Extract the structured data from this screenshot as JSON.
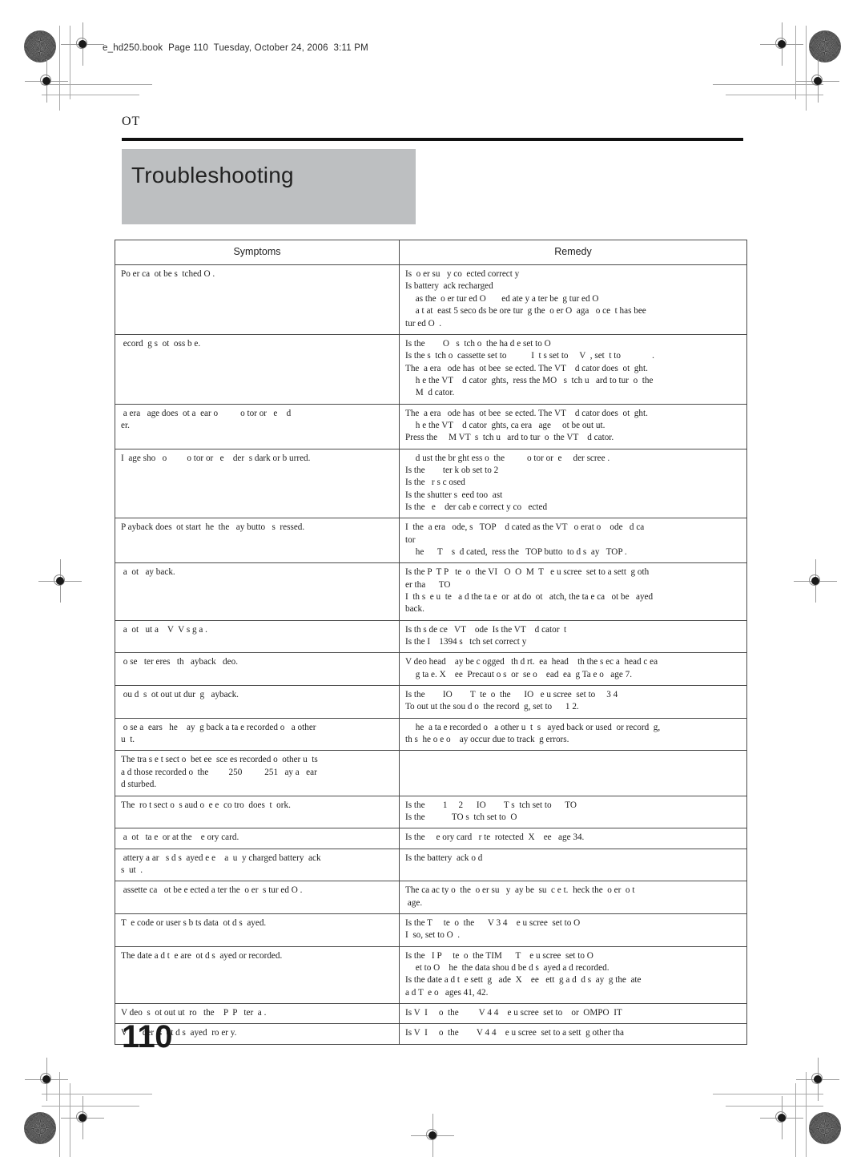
{
  "header": {
    "file_info": "e_hd250.book  Page 110  Tuesday, October 24, 2006  3:11 PM"
  },
  "page": {
    "chapter_label": "OT",
    "title": "Troubleshooting",
    "folio": "110"
  },
  "table": {
    "columns": [
      "Symptoms",
      "Remedy"
    ],
    "rows": [
      {
        "symptom": [
          "Po er ca  ot be s  tched O ."
        ],
        "remedy": [
          "Is  o er su   y co  ected correct y",
          "Is battery  ack recharged",
          " as the  o er tur ed O       ed ate y a ter be  g tur ed O",
          " a t at  east 5 seco ds be ore tur  g the  o er O  aga   o ce  t has bee",
          "tur ed O  ."
        ],
        "remedy_indent": [
          false,
          false,
          true,
          true,
          false
        ]
      },
      {
        "symptom": [
          " ecord  g s  ot  oss b e."
        ],
        "remedy": [
          "Is the        O   s  tch o  the ha d e set to O",
          "Is the s  tch o  cassette set to           I  t s set to     V  , set  t to              .",
          "The  a era   ode has  ot bee  se ected. The VT    d cator does  ot  ght.",
          " h e the VT    d cator  ghts,  ress the MO   s  tch u   ard to tur  o  the",
          " M  d cator."
        ],
        "remedy_indent": [
          false,
          false,
          false,
          true,
          true
        ]
      },
      {
        "symptom": [
          " a era   age does  ot a  ear o          o tor or   e    d",
          "er."
        ],
        "remedy": [
          "The  a era   ode has  ot bee  se ected. The VT    d cator does  ot  ght.",
          " h e the VT    d cator  ghts, ca era   age     ot be out ut.",
          "Press the     M VT  s  tch u   ard to tur  o  the VT    d cator."
        ],
        "remedy_indent": [
          false,
          true,
          false
        ]
      },
      {
        "symptom": [
          "I  age sho   o         o tor or   e    der  s dark or b urred."
        ],
        "remedy": [
          " d ust the br ght ess o  the          o tor or  e     der scree .",
          "Is the        ter k ob set to 2",
          "Is the   r s c osed",
          "Is the shutter s  eed too  ast",
          "Is the   e    der cab e correct y co   ected"
        ],
        "remedy_indent": [
          true,
          false,
          false,
          false,
          false
        ]
      },
      {
        "symptom": [
          "P ayback does  ot start  he  the   ay butto   s  ressed."
        ],
        "remedy": [
          "I  the  a era   ode, s   TOP    d cated as the VT   o erat o    ode   d ca",
          "tor",
          " he      T    s  d cated,  ress the   TOP butto  to d s  ay   TOP ."
        ],
        "remedy_indent": [
          false,
          false,
          true
        ]
      },
      {
        "symptom": [
          " a  ot   ay back."
        ],
        "remedy": [
          "Is the P  T P   te  o  the VI   O  O  M  T   e u scree  set to a sett  g oth",
          "er tha      TO",
          "I  th s  e u  te   a d the ta e  or  at do  ot   atch, the ta e ca   ot be   ayed",
          "back."
        ],
        "remedy_indent": [
          false,
          false,
          false,
          false
        ]
      },
      {
        "symptom": [
          " a  ot   ut a    V  V s g a ."
        ],
        "remedy": [
          "Is th s de ce   VT    ode  Is the VT    d cator  t",
          "Is the I    1394 s   tch set correct y"
        ],
        "remedy_indent": [
          false,
          false
        ]
      },
      {
        "symptom": [
          " o se   ter eres   th   ayback   deo."
        ],
        "remedy": [
          "V deo head    ay be c ogged   th d rt.  ea  head    th the s ec a  head c ea",
          " g ta e. X    ee  Precaut o s  or  se o    ead  ea  g Ta e o   age 7."
        ],
        "remedy_indent": [
          false,
          true
        ]
      },
      {
        "symptom": [
          " ou d  s  ot out ut dur  g   ayback."
        ],
        "remedy": [
          "Is the        IO        T  te  o  the      IO   e u scree  set to     3 4",
          "To out ut the sou d o  the record  g, set to      1 2."
        ],
        "remedy_indent": [
          false,
          false
        ]
      },
      {
        "symptom": [
          " o se a  ears   he    ay  g back a ta e recorded o   a other",
          "u  t."
        ],
        "remedy": [
          " he  a ta e recorded o   a other u  t  s   ayed back or used  or record  g,",
          "th s  he o e o    ay occur due to track  g errors."
        ],
        "remedy_indent": [
          true,
          false
        ]
      },
      {
        "symptom": [
          "The tra s e t sect o  bet ee  sce es recorded o  other u  ts",
          "a d those recorded o  the         250          251   ay a   ear",
          "d sturbed."
        ],
        "remedy": [],
        "remedy_indent": []
      },
      {
        "symptom": [
          "The  ro t sect o  s aud o  e e  co tro  does  t  ork."
        ],
        "remedy": [
          "Is the        1     2      IO        T s  tch set to      TO",
          "Is the            TO s  tch set to  O"
        ],
        "remedy_indent": [
          false,
          false
        ]
      },
      {
        "symptom": [
          " a  ot   ta e  or at the    e ory card."
        ],
        "remedy": [
          "Is the     e ory card   r te  rotected  X    ee   age 34."
        ],
        "remedy_indent": [
          false
        ]
      },
      {
        "symptom": [
          " attery a ar   s d s  ayed e e    a  u  y charged battery  ack",
          "s  ut  ."
        ],
        "remedy": [
          "Is the battery  ack o d"
        ],
        "remedy_indent": [
          false
        ]
      },
      {
        "symptom": [
          " assette ca   ot be e ected a ter the  o er  s tur ed O ."
        ],
        "remedy": [
          "The ca ac ty o  the  o er su   y  ay be  su  c e t.  heck the  o er  o t",
          " age."
        ],
        "remedy_indent": [
          false,
          false
        ]
      },
      {
        "symptom": [
          "T  e code or user s b ts data  ot d s  ayed."
        ],
        "remedy": [
          "Is the T     te  o  the      V 3 4    e u scree  set to O",
          "I  so, set to O  ."
        ],
        "remedy_indent": [
          false,
          false
        ]
      },
      {
        "symptom": [
          "The date a d t  e are  ot d s  ayed or recorded."
        ],
        "remedy": [
          "Is the   I P     te  o  the TIM      T    e u scree  set to O",
          " et to O    he  the data shou d be d s  ayed a d recorded.",
          "Is the date a d t  e sett  g   ade  X    ee   ett  g a d  d s  ay  g the  ate",
          "a d T  e o   ages 41, 42."
        ],
        "remedy_indent": [
          false,
          true,
          false,
          false
        ]
      },
      {
        "symptom": [
          "V deo  s  ot out ut  ro   the    P  P   ter  a ."
        ],
        "remedy": [
          "Is V  I     o  the         V 4 4    e u scree  set to    or  OMPO  IT"
        ],
        "remedy_indent": [
          false
        ]
      },
      {
        "symptom": [
          "V e    der  s  ot d s  ayed  ro er y."
        ],
        "remedy": [
          "Is V  I     o  the        V 4 4    e u scree  set to a sett  g other tha"
        ],
        "remedy_indent": [
          false
        ]
      }
    ]
  }
}
